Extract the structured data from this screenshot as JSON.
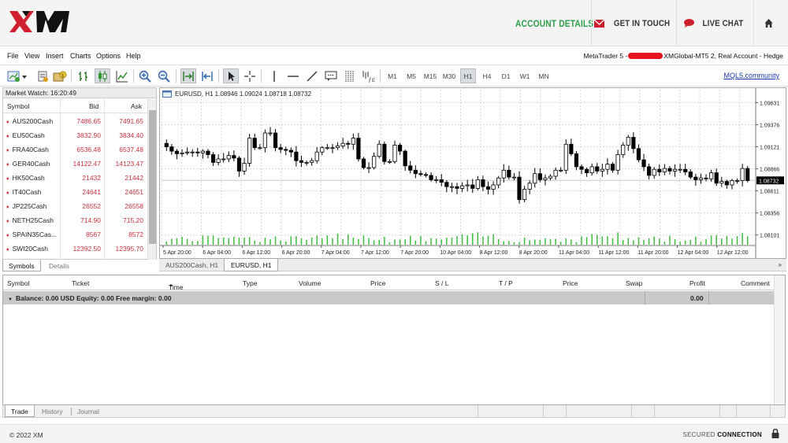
{
  "site": {
    "nav": {
      "account": "ACCOUNT DETAILS",
      "touch": "GET IN TOUCH",
      "chat": "LIVE CHAT"
    },
    "footer": {
      "copyright": "© 2022 XM",
      "secured": "SECURED",
      "connection": "CONNECTION"
    }
  },
  "menu": [
    "File",
    "View",
    "Insert",
    "Charts",
    "Options",
    "Help"
  ],
  "account": {
    "prefix": "MetaTrader 5 -",
    "suffix": "XMGlobal-MT5 2, Real Account - Hedge"
  },
  "toolbar": {
    "timeframes": [
      "M1",
      "M5",
      "M15",
      "M30",
      "H1",
      "H4",
      "D1",
      "W1",
      "MN"
    ],
    "active_timeframe": "H1",
    "mql": "MQL5.community"
  },
  "market_watch": {
    "title": "Market Watch: 16:20:49",
    "headers": {
      "symbol": "Symbol",
      "bid": "Bid",
      "ask": "Ask"
    },
    "rows": [
      {
        "symbol": "AUS200Cash",
        "bid": "7486.65",
        "ask": "7491.65"
      },
      {
        "symbol": "EU50Cash",
        "bid": "3832.90",
        "ask": "3834.40"
      },
      {
        "symbol": "FRA40Cash",
        "bid": "6536.48",
        "ask": "6537.48"
      },
      {
        "symbol": "GER40Cash",
        "bid": "14122.47",
        "ask": "14123.47"
      },
      {
        "symbol": "HK50Cash",
        "bid": "21432",
        "ask": "21442"
      },
      {
        "symbol": "IT40Cash",
        "bid": "24641",
        "ask": "24651"
      },
      {
        "symbol": "JP225Cash",
        "bid": "26552",
        "ask": "26558"
      },
      {
        "symbol": "NETH25Cash",
        "bid": "714.90",
        "ask": "715.20"
      },
      {
        "symbol": "SPAIN35Cas...",
        "bid": "8567",
        "ask": "8572"
      },
      {
        "symbol": "SWI20Cash",
        "bid": "12392.50",
        "ask": "12395.70"
      }
    ],
    "tabs": [
      "Symbols",
      "Details"
    ]
  },
  "chart": {
    "header": "EURUSD, H1  1.08946 1.09024 1.08718 1.08732",
    "price_labels": [
      "1.09631",
      "1.09376",
      "1.09121",
      "1.08866",
      "1.08611",
      "1.08356",
      "1.08101"
    ],
    "current_price": "1.08732",
    "time_labels": [
      "5 Apr 20:00",
      "6 Apr 04:00",
      "6 Apr 12:00",
      "6 Apr 20:00",
      "7 Apr 04:00",
      "7 Apr 12:00",
      "7 Apr 20:00",
      "10 Apr 04:00",
      "8 Apr 12:00",
      "8 Apr 20:00",
      "11 Apr 04:00",
      "11 Apr 12:00",
      "11 Apr 20:00",
      "12 Apr 04:00",
      "12 Apr 12:00"
    ],
    "tabs": [
      "AUS200Cash, H1",
      "EURUSD, H1"
    ]
  },
  "chart_data": {
    "type": "candlestick",
    "symbol": "EURUSD",
    "timeframe": "H1",
    "ylim": [
      1.0798,
      1.0978
    ],
    "closes": [
      1.0912,
      1.0907,
      1.0904,
      1.0905,
      1.0906,
      1.0906,
      1.0905,
      1.0907,
      1.0903,
      1.0894,
      1.0898,
      1.0898,
      1.0902,
      1.0899,
      1.0884,
      1.0893,
      1.0922,
      1.0911,
      1.0911,
      1.0928,
      1.0928,
      1.0911,
      1.0909,
      1.0908,
      1.0906,
      1.0896,
      1.0894,
      1.0894,
      1.0896,
      1.0906,
      1.0911,
      1.0911,
      1.0911,
      1.0913,
      1.0916,
      1.0915,
      1.0922,
      1.0898,
      1.0888,
      1.0888,
      1.0901,
      1.0915,
      1.0895,
      1.0895,
      1.0914,
      1.0907,
      1.089,
      1.0885,
      1.0881,
      1.088,
      1.0879,
      1.0874,
      1.0874,
      1.0871,
      1.0866,
      1.0866,
      1.0864,
      1.0867,
      1.0868,
      1.0864,
      1.0874,
      1.0866,
      1.0863,
      1.0868,
      1.0876,
      1.0885,
      1.0877,
      1.0877,
      1.0851,
      1.0863,
      1.087,
      1.0881,
      1.0874,
      1.0876,
      1.0878,
      1.0885,
      1.0885,
      1.0915,
      1.0904,
      1.0889,
      1.0886,
      1.0882,
      1.0889,
      1.0884,
      1.0886,
      1.0892,
      1.0885,
      1.0903,
      1.0914,
      1.0923,
      1.091,
      1.0897,
      1.0889,
      1.0879,
      1.0886,
      1.0883,
      1.0887,
      1.0884,
      1.0886,
      1.0886,
      1.0883,
      1.0877,
      1.0874,
      1.0876,
      1.0875,
      1.0882,
      1.087,
      1.0872,
      1.0868,
      1.0873,
      1.0873,
      1.0887,
      1.0873
    ]
  },
  "terminal": {
    "headers": [
      "Symbol",
      "Ticket",
      "Time",
      "Type",
      "Volume",
      "Price",
      "S / L",
      "T / P",
      "Price",
      "Swap",
      "Profit",
      "Comment"
    ],
    "balance_line": "Balance: 0.00 USD  Equity: 0.00  Free margin: 0.00",
    "profit": "0.00",
    "tabs": [
      "Trade",
      "History",
      "Journal"
    ]
  },
  "colors": {
    "brand_green": "#2e9e4a",
    "bull": "#ffffff",
    "bear": "#000000",
    "price_red": "#c8323c",
    "volume": "#3dbb3d"
  }
}
